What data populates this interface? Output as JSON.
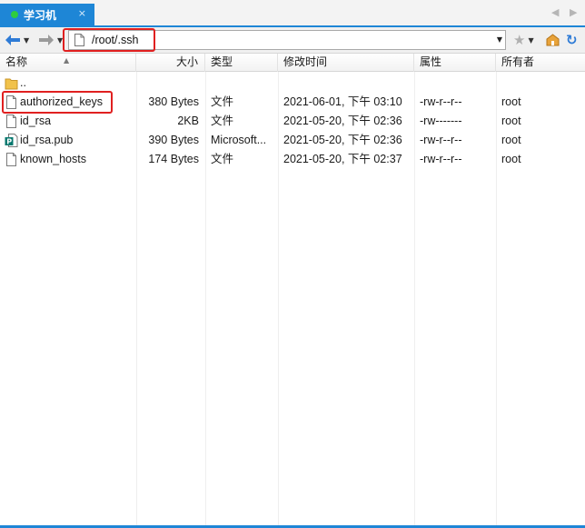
{
  "tab": {
    "title": "学习机",
    "close_label": "×",
    "status_color": "#2ecc40",
    "accent": "#1e86d6"
  },
  "tab_nav": {
    "left": "◀",
    "right": "▶"
  },
  "toolbar": {
    "back_icon": "back-arrow-icon",
    "forward_icon": "forward-arrow-icon",
    "dropdown": "▼",
    "address_path": "/root/.ssh",
    "star": "★",
    "home": "⌂",
    "refresh": "↻"
  },
  "columns": {
    "name": "名称",
    "size": "大小",
    "type": "类型",
    "modified": "修改时间",
    "attributes": "属性",
    "owner": "所有者"
  },
  "rows": [
    {
      "icon": "folder-icon",
      "name": "..",
      "size": "",
      "type": "",
      "modified": "",
      "attributes": "",
      "owner": ""
    },
    {
      "icon": "file-icon",
      "name": "authorized_keys",
      "size": "380 Bytes",
      "type": "文件",
      "modified": "2021-06-01, 下午 03:10",
      "attributes": "-rw-r--r--",
      "owner": "root"
    },
    {
      "icon": "file-icon",
      "name": "id_rsa",
      "size": "2KB",
      "type": "文件",
      "modified": "2021-05-20, 下午 02:36",
      "attributes": "-rw-------",
      "owner": "root"
    },
    {
      "icon": "publisher-file-icon",
      "name": "id_rsa.pub",
      "size": "390 Bytes",
      "type": "Microsoft...",
      "modified": "2021-05-20, 下午 02:36",
      "attributes": "-rw-r--r--",
      "owner": "root"
    },
    {
      "icon": "file-icon",
      "name": "known_hosts",
      "size": "174 Bytes",
      "type": "文件",
      "modified": "2021-05-20, 下午 02:37",
      "attributes": "-rw-r--r--",
      "owner": "root"
    }
  ],
  "highlight_color": "#e02020"
}
